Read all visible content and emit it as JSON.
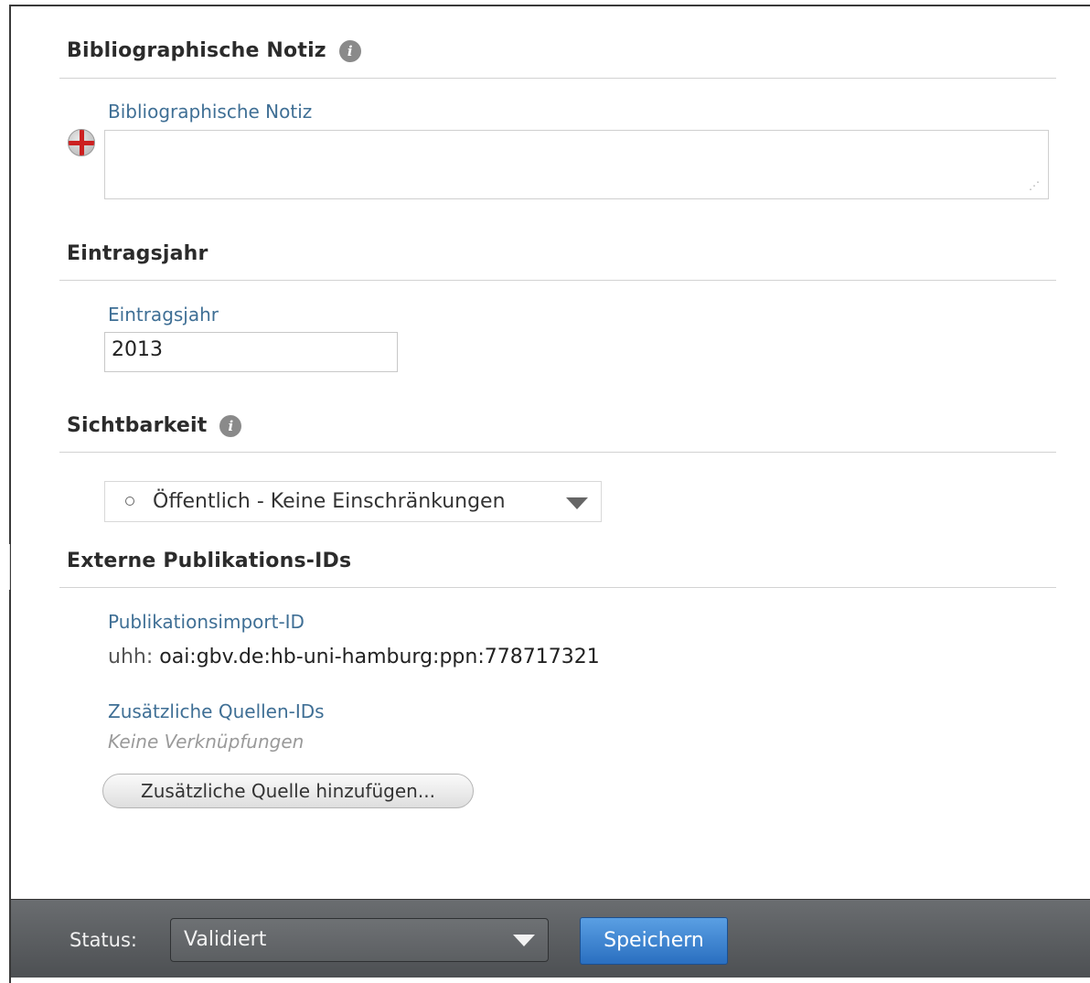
{
  "sections": {
    "bibliographic_note": {
      "title": "Bibliographische Notiz",
      "field_label": "Bibliographische Notiz",
      "value": ""
    },
    "entry_year": {
      "title": "Eintragsjahr",
      "field_label": "Eintragsjahr",
      "value": "2013"
    },
    "visibility": {
      "title": "Sichtbarkeit",
      "selected": "Öffentlich - Keine Einschränkungen"
    },
    "external_ids": {
      "title": "Externe Publikations-IDs",
      "import_label": "Publikationsimport-ID",
      "import_prefix": "uhh:",
      "import_value": "oai:gbv.de:hb-uni-hamburg:ppn:778717321",
      "additional_label": "Zusätzliche Quellen-IDs",
      "no_links": "Keine Verknüpfungen",
      "add_button": "Zusätzliche Quelle hinzufügen..."
    }
  },
  "footer": {
    "status_label": "Status:",
    "status_value": "Validiert",
    "save_label": "Speichern"
  },
  "icons": {
    "info": "info-icon",
    "language_flag": "uk-flag-icon"
  },
  "colors": {
    "label_blue": "#3f6f95",
    "save_button": "#2a6fc0",
    "footer_bg": "#55585b"
  }
}
